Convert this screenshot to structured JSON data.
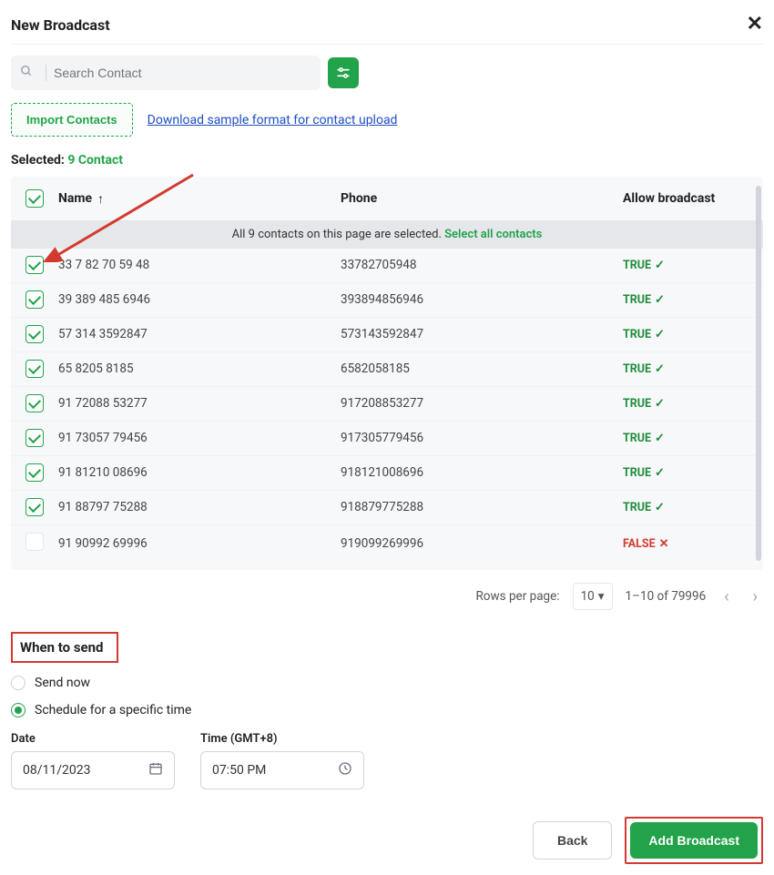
{
  "header": {
    "title": "New Broadcast"
  },
  "search": {
    "placeholder": "Search Contact"
  },
  "actions": {
    "import_label": "Import Contacts",
    "download_link": "Download sample format for contact upload"
  },
  "selection": {
    "label": "Selected:",
    "count_text": "9 Contact",
    "banner_prefix": "All 9 contacts on this page are selected.",
    "banner_link": "Select all contacts"
  },
  "columns": {
    "name": "Name",
    "phone": "Phone",
    "allow": "Allow broadcast"
  },
  "allow_labels": {
    "t": "TRUE",
    "f": "FALSE"
  },
  "rows": [
    {
      "checked": true,
      "name": "33 7 82 70 59 48",
      "phone": "33782705948",
      "allow": true
    },
    {
      "checked": true,
      "name": "39 389 485 6946",
      "phone": "393894856946",
      "allow": true
    },
    {
      "checked": true,
      "name": "57 314 3592847",
      "phone": "573143592847",
      "allow": true
    },
    {
      "checked": true,
      "name": "65 8205 8185",
      "phone": "6582058185",
      "allow": true
    },
    {
      "checked": true,
      "name": "91 72088 53277",
      "phone": "917208853277",
      "allow": true
    },
    {
      "checked": true,
      "name": "91 73057 79456",
      "phone": "917305779456",
      "allow": true
    },
    {
      "checked": true,
      "name": "91 81210 08696",
      "phone": "918121008696",
      "allow": true
    },
    {
      "checked": true,
      "name": "91 88797 75288",
      "phone": "918879775288",
      "allow": true
    },
    {
      "checked": false,
      "name": "91 90992 69996",
      "phone": "919099269996",
      "allow": false
    }
  ],
  "pagination": {
    "rows_label": "Rows per page:",
    "rows_value": "10",
    "range": "1–10 of 79996"
  },
  "schedule": {
    "heading": "When to send",
    "send_now": "Send now",
    "schedule_specific": "Schedule for a specific time",
    "date_label": "Date",
    "date_value": "08/11/2023",
    "time_label": "Time (GMT+8)",
    "time_value": "07:50 PM"
  },
  "footer": {
    "back": "Back",
    "add": "Add Broadcast"
  }
}
